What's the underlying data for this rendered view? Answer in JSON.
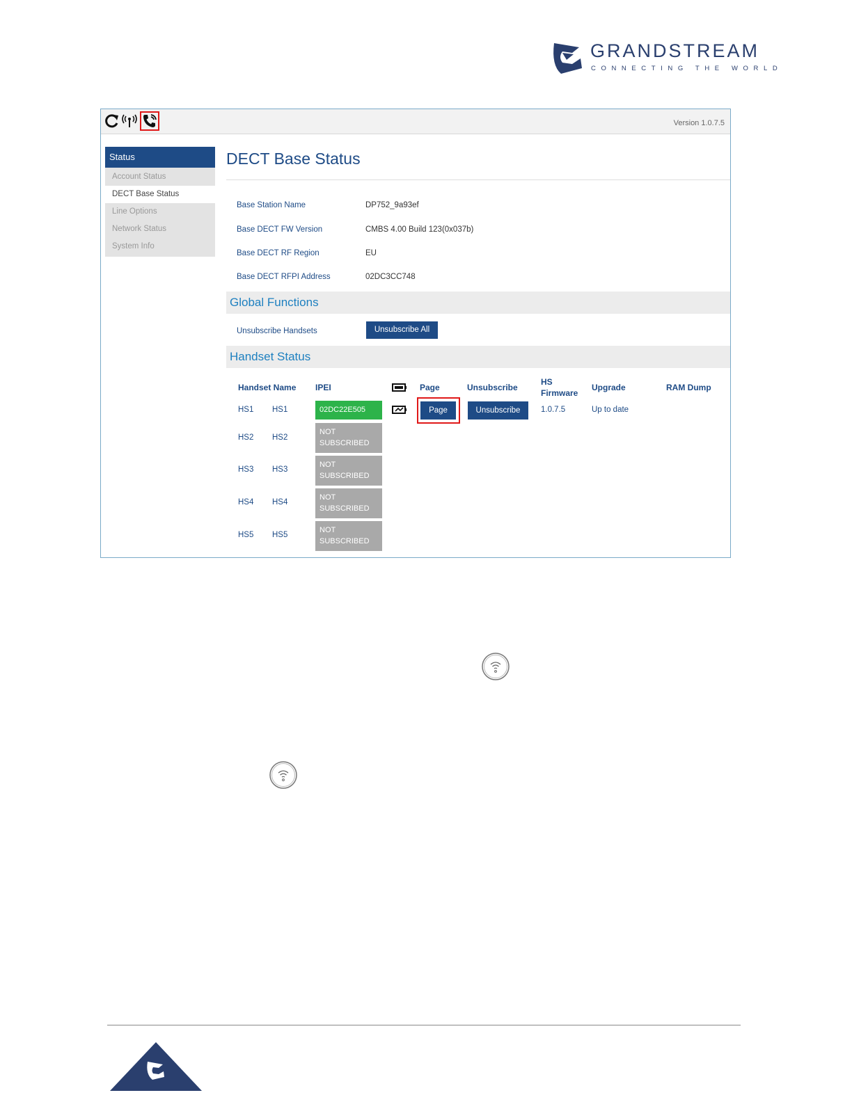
{
  "brand": {
    "name": "GRANDSTREAM",
    "tagline": "CONNECTING THE WORLD",
    "colors": {
      "primary": "#2a3f6e",
      "accent": "#1e4b86"
    }
  },
  "topbar": {
    "icons": [
      "refresh-icon",
      "signal-icon",
      "phone-ring-icon"
    ],
    "version": "Version 1.0.7.5"
  },
  "sidebar": {
    "header": "Status",
    "items": [
      {
        "label": "Account Status",
        "active": false
      },
      {
        "label": "DECT Base Status",
        "active": true
      },
      {
        "label": "Line Options",
        "active": false
      },
      {
        "label": "Network Status",
        "active": false
      },
      {
        "label": "System Info",
        "active": false
      }
    ]
  },
  "main": {
    "title": "DECT Base Status",
    "info": [
      {
        "label": "Base Station Name",
        "value": "DP752_9a93ef"
      },
      {
        "label": "Base DECT FW Version",
        "value": "CMBS 4.00 Build 123(0x037b)"
      },
      {
        "label": "Base DECT RF Region",
        "value": "EU"
      },
      {
        "label": "Base DECT RFPI Address",
        "value": "02DC3CC748"
      }
    ],
    "global_functions": {
      "title": "Global Functions",
      "unsubscribe_label": "Unsubscribe Handsets",
      "unsubscribe_button": "Unsubscribe All"
    },
    "handset_status": {
      "title": "Handset Status",
      "columns": {
        "handset_name": "Handset Name",
        "ipei": "IPEI",
        "page": "Page",
        "unsubscribe": "Unsubscribe",
        "hs_firmware_1": "HS",
        "hs_firmware_2": "Firmware",
        "upgrade": "Upgrade",
        "ram_dump": "RAM Dump"
      },
      "rows": [
        {
          "id": "HS1",
          "name": "HS1",
          "ipei": "02DC22E505",
          "subscribed": true,
          "page_button": "Page",
          "unsubscribe_button": "Unsubscribe",
          "firmware": "1.0.7.5",
          "upgrade": "Up to date"
        },
        {
          "id": "HS2",
          "name": "HS2",
          "ipei_1": "NOT",
          "ipei_2": "SUBSCRIBED",
          "subscribed": false
        },
        {
          "id": "HS3",
          "name": "HS3",
          "ipei_1": "NOT",
          "ipei_2": "SUBSCRIBED",
          "subscribed": false
        },
        {
          "id": "HS4",
          "name": "HS4",
          "ipei_1": "NOT",
          "ipei_2": "SUBSCRIBED",
          "subscribed": false
        },
        {
          "id": "HS5",
          "name": "HS5",
          "ipei_1": "NOT",
          "ipei_2": "SUBSCRIBED",
          "subscribed": false
        }
      ]
    }
  },
  "inline_icons": [
    "paging-key-icon",
    "paging-key-icon"
  ]
}
